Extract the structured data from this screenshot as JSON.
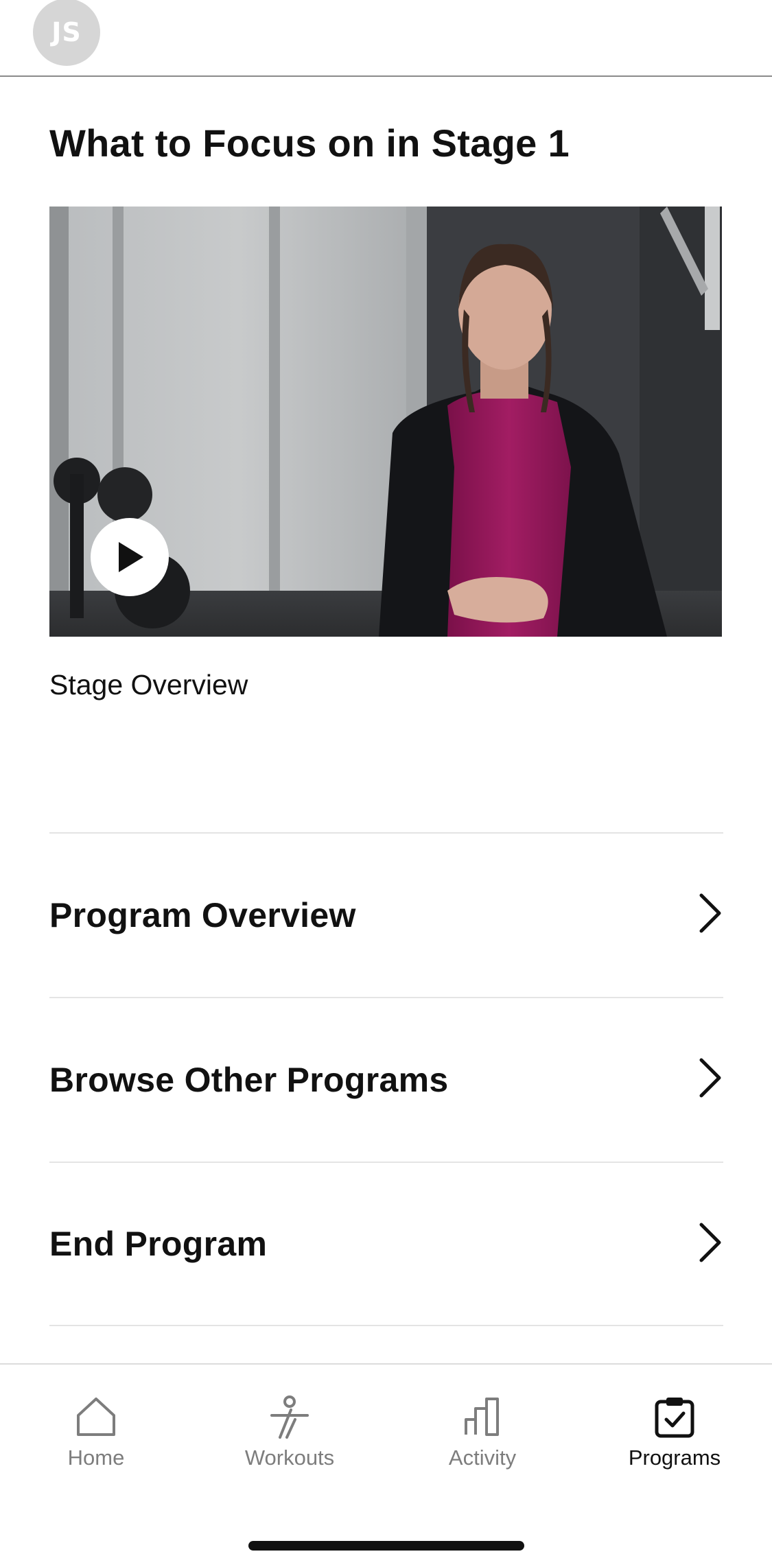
{
  "header": {
    "avatar_initials": "JS"
  },
  "section": {
    "title": "What to Focus on in Stage 1"
  },
  "video": {
    "caption": "Stage Overview"
  },
  "menu": {
    "items": [
      {
        "label": "Program Overview"
      },
      {
        "label": "Browse Other Programs"
      },
      {
        "label": "End Program"
      }
    ]
  },
  "tab_bar": {
    "tabs": [
      {
        "label": "Home",
        "icon": "home-icon",
        "active": false
      },
      {
        "label": "Workouts",
        "icon": "runner-icon",
        "active": false
      },
      {
        "label": "Activity",
        "icon": "bar-chart-icon",
        "active": false
      },
      {
        "label": "Programs",
        "icon": "clipboard-check-icon",
        "active": true
      }
    ]
  },
  "colors": {
    "text": "#111111",
    "inactive_tab": "#7d7d7d",
    "divider": "#e4e4e4",
    "avatar_bg": "#d6d6d6",
    "shirt": "#9b1a5e"
  }
}
